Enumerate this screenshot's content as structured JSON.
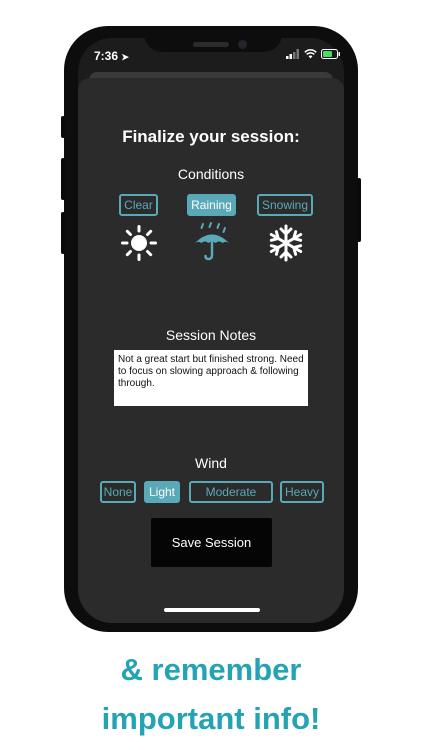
{
  "status": {
    "time": "7:36",
    "location_glyph": "➤"
  },
  "title": "Finalize your session:",
  "conditions": {
    "label": "Conditions",
    "options": [
      {
        "label": "Clear",
        "icon": "sun-icon",
        "selected": false
      },
      {
        "label": "Raining",
        "icon": "umbrella-rain-icon",
        "selected": true
      },
      {
        "label": "Snowing",
        "icon": "snowflake-icon",
        "selected": false
      }
    ]
  },
  "notes": {
    "label": "Session Notes",
    "value": "Not a great start but finished strong. Need to focus on slowing approach & following through."
  },
  "wind": {
    "label": "Wind",
    "options": [
      {
        "label": "None",
        "selected": false
      },
      {
        "label": "Light",
        "selected": true
      },
      {
        "label": "Moderate",
        "selected": false
      },
      {
        "label": "Heavy",
        "selected": false
      }
    ]
  },
  "save_label": "Save Session",
  "caption": {
    "line1": "& remember",
    "line2": "important info!"
  },
  "colors": {
    "accent": "#5aa9b8",
    "caption": "#23a3b3",
    "panel": "#2b2b2b"
  }
}
